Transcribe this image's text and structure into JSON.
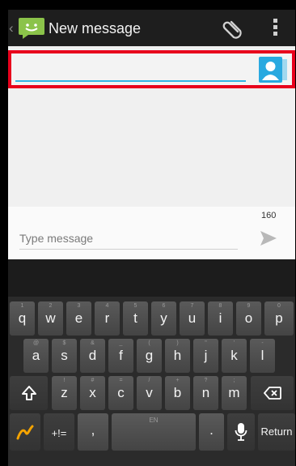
{
  "action_bar": {
    "title": "New message",
    "up_icon": "chevron-left",
    "app_icon": "messaging-app-icon",
    "attach_icon": "paperclip-icon",
    "overflow_icon": "overflow-menu-icon"
  },
  "recipient": {
    "value": "",
    "placeholder": "",
    "highlight_color": "#e8001c",
    "accent_color": "#33b5e5",
    "contact_icon": "contact-picker-icon"
  },
  "compose": {
    "char_count": "160",
    "placeholder": "Type message",
    "value": "",
    "send_icon": "send-icon"
  },
  "keyboard": {
    "row1": [
      {
        "k": "q",
        "s": "1"
      },
      {
        "k": "w",
        "s": "2"
      },
      {
        "k": "e",
        "s": "3"
      },
      {
        "k": "r",
        "s": "4"
      },
      {
        "k": "t",
        "s": "5"
      },
      {
        "k": "y",
        "s": "6"
      },
      {
        "k": "u",
        "s": "7"
      },
      {
        "k": "i",
        "s": "8"
      },
      {
        "k": "o",
        "s": "9"
      },
      {
        "k": "p",
        "s": "0"
      }
    ],
    "row2": [
      {
        "k": "a",
        "s": "@"
      },
      {
        "k": "s",
        "s": "$"
      },
      {
        "k": "d",
        "s": "&"
      },
      {
        "k": "f",
        "s": "_"
      },
      {
        "k": "g",
        "s": "("
      },
      {
        "k": "h",
        "s": ")"
      },
      {
        "k": "j",
        "s": "\""
      },
      {
        "k": "k",
        "s": "'"
      },
      {
        "k": "l",
        "s": "-"
      }
    ],
    "row3": [
      {
        "k": "z",
        "s": "!"
      },
      {
        "k": "x",
        "s": "#"
      },
      {
        "k": "c",
        "s": "="
      },
      {
        "k": "v",
        "s": "/"
      },
      {
        "k": "b",
        "s": "+"
      },
      {
        "k": "n",
        "s": "?"
      },
      {
        "k": "m",
        "s": ";"
      }
    ],
    "symbols_label": "+!=",
    "comma_label": ",",
    "period_label": ".",
    "space_label": "EN",
    "return_label": "Return",
    "shift_icon": "shift-icon",
    "backspace_icon": "backspace-icon",
    "swype_icon": "swype-icon",
    "mic_icon": "microphone-icon",
    "key_color": "#4c4c4c"
  }
}
